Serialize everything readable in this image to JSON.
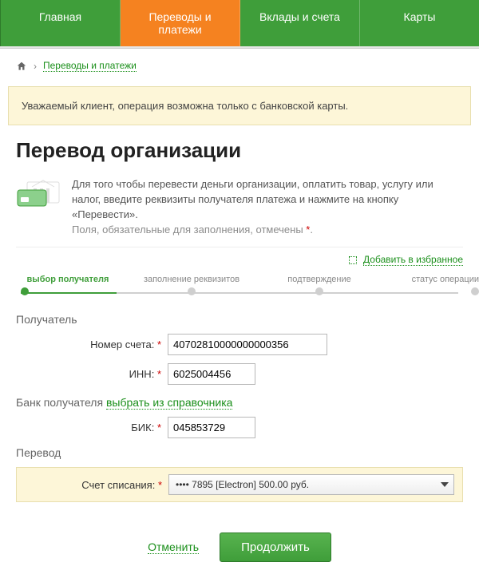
{
  "nav": {
    "tabs": [
      {
        "label": "Главная"
      },
      {
        "label": "Переводы и платежи"
      },
      {
        "label": "Вклады и счета"
      },
      {
        "label": "Карты"
      }
    ],
    "active_index": 1
  },
  "breadcrumb": {
    "current_link": "Переводы и платежи",
    "separator": "›"
  },
  "alert": {
    "text": "Уважаемый клиент, операция возможна только с банковской карты."
  },
  "page": {
    "title": "Перевод организации",
    "intro": "Для того чтобы перевести деньги организации, оплатить товар, услугу или налог, введите реквизиты получателя платежа и нажмите на кнопку «Перевести».",
    "intro_muted": "Поля, обязательные для заполнения, отмечены",
    "intro_star": "*",
    "intro_period": "."
  },
  "add_favorite": {
    "label": "Добавить в избранное"
  },
  "steps": [
    {
      "label": "выбор получателя",
      "active": true
    },
    {
      "label": "заполнение реквизитов",
      "active": false
    },
    {
      "label": "подтверждение",
      "active": false
    },
    {
      "label": "статус операции",
      "active": false
    }
  ],
  "form": {
    "section_recipient": "Получатель",
    "account_label": "Номер счета:",
    "account_value": "40702810000000000356",
    "inn_label": "ИНН:",
    "inn_value": "6025004456",
    "bank_section": "Банк получателя",
    "bank_link": "выбрать из справочника",
    "bik_label": "БИК:",
    "bik_value": "045853729",
    "transfer_section": "Перевод",
    "debit_label": "Счет списания:",
    "debit_value": "•••• 7895 [Electron] 500.00 руб."
  },
  "actions": {
    "cancel": "Отменить",
    "continue": "Продолжить"
  }
}
